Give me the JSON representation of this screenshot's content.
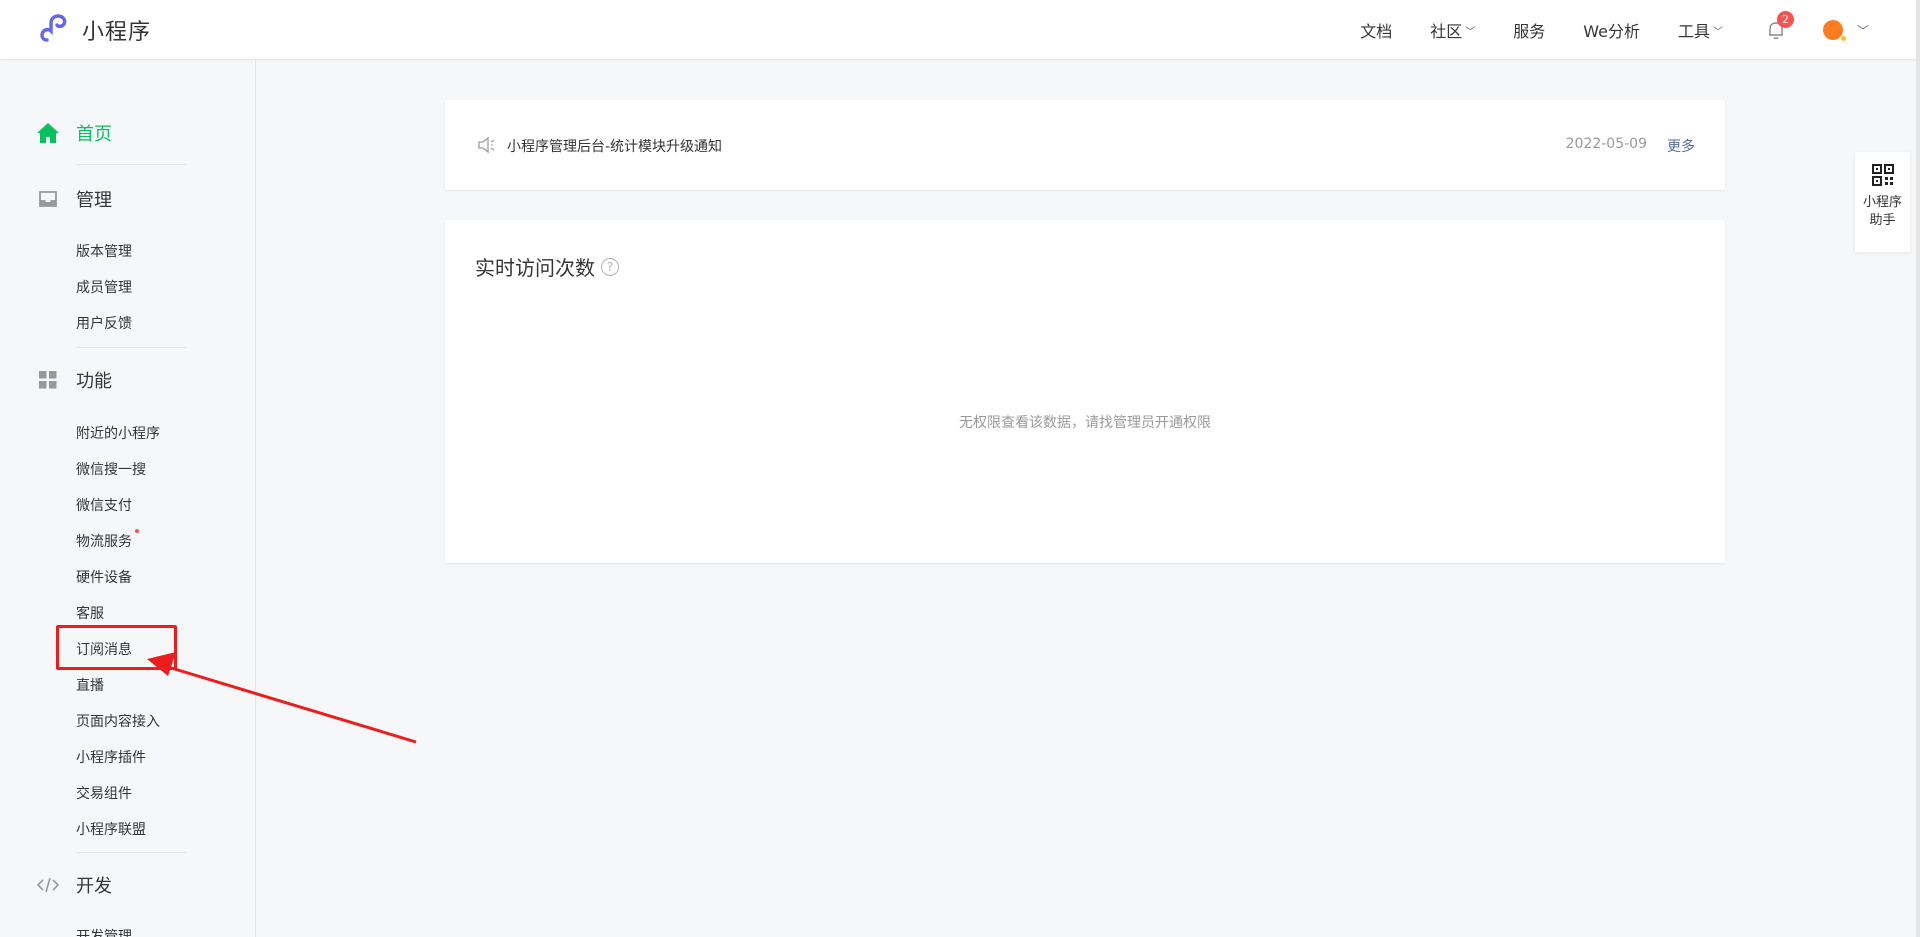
{
  "header": {
    "app_name": "小程序",
    "nav": [
      {
        "label": "文档",
        "dropdown": false
      },
      {
        "label": "社区",
        "dropdown": true
      },
      {
        "label": "服务",
        "dropdown": false
      },
      {
        "label": "We分析",
        "dropdown": false
      },
      {
        "label": "工具",
        "dropdown": true
      }
    ],
    "notification_count": "2",
    "brand_color": "#07c160"
  },
  "sidebar": {
    "home": "首页",
    "manage": {
      "title": "管理",
      "items": [
        "版本管理",
        "成员管理",
        "用户反馈"
      ]
    },
    "features": {
      "title": "功能",
      "items": [
        "附近的小程序",
        "微信搜一搜",
        "微信支付",
        "物流服务",
        "硬件设备",
        "客服",
        "订阅消息",
        "直播",
        "页面内容接入",
        "小程序插件",
        "交易组件",
        "小程序联盟"
      ]
    },
    "develop": {
      "title": "开发",
      "items": [
        "开发管理"
      ]
    }
  },
  "notice": {
    "text": "小程序管理后台-统计模块升级通知",
    "date": "2022-05-09",
    "more": "更多"
  },
  "realtime": {
    "title": "实时访问次数",
    "help": "?",
    "empty_text": "无权限查看该数据，请找管理员开通权限"
  },
  "helper": {
    "line1": "小程序",
    "line2": "助手"
  },
  "annotation": {
    "highlighted_item": "订阅消息",
    "color": "#ee1c1c"
  }
}
